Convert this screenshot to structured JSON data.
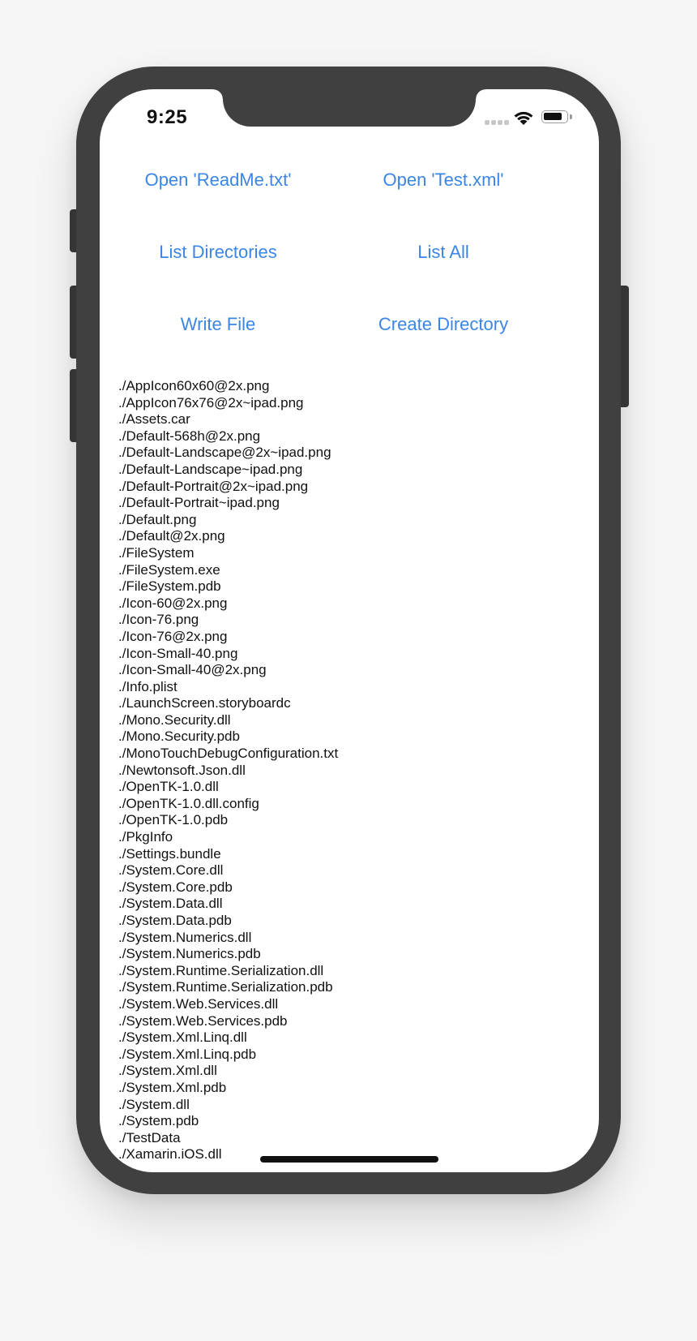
{
  "status_bar": {
    "time": "9:25"
  },
  "buttons": {
    "open_readme": "Open 'ReadMe.txt'",
    "open_test_xml": "Open 'Test.xml'",
    "list_directories": "List Directories",
    "list_all": "List All",
    "write_file": "Write File",
    "create_directory": "Create Directory"
  },
  "files": [
    "./AppIcon60x60@2x.png",
    "./AppIcon76x76@2x~ipad.png",
    "./Assets.car",
    "./Default-568h@2x.png",
    "./Default-Landscape@2x~ipad.png",
    "./Default-Landscape~ipad.png",
    "./Default-Portrait@2x~ipad.png",
    "./Default-Portrait~ipad.png",
    "./Default.png",
    "./Default@2x.png",
    "./FileSystem",
    "./FileSystem.exe",
    "./FileSystem.pdb",
    "./Icon-60@2x.png",
    "./Icon-76.png",
    "./Icon-76@2x.png",
    "./Icon-Small-40.png",
    "./Icon-Small-40@2x.png",
    "./Info.plist",
    "./LaunchScreen.storyboardc",
    "./Mono.Security.dll",
    "./Mono.Security.pdb",
    "./MonoTouchDebugConfiguration.txt",
    "./Newtonsoft.Json.dll",
    "./OpenTK-1.0.dll",
    "./OpenTK-1.0.dll.config",
    "./OpenTK-1.0.pdb",
    "./PkgInfo",
    "./Settings.bundle",
    "./System.Core.dll",
    "./System.Core.pdb",
    "./System.Data.dll",
    "./System.Data.pdb",
    "./System.Numerics.dll",
    "./System.Numerics.pdb",
    "./System.Runtime.Serialization.dll",
    "./System.Runtime.Serialization.pdb",
    "./System.Web.Services.dll",
    "./System.Web.Services.pdb",
    "./System.Xml.Linq.dll",
    "./System.Xml.Linq.pdb",
    "./System.Xml.dll",
    "./System.Xml.pdb",
    "./System.dll",
    "./System.pdb",
    "./TestData",
    "./Xamarin.iOS.dll"
  ],
  "colors": {
    "accent": "#3b86e4",
    "device_frame": "#404040"
  }
}
